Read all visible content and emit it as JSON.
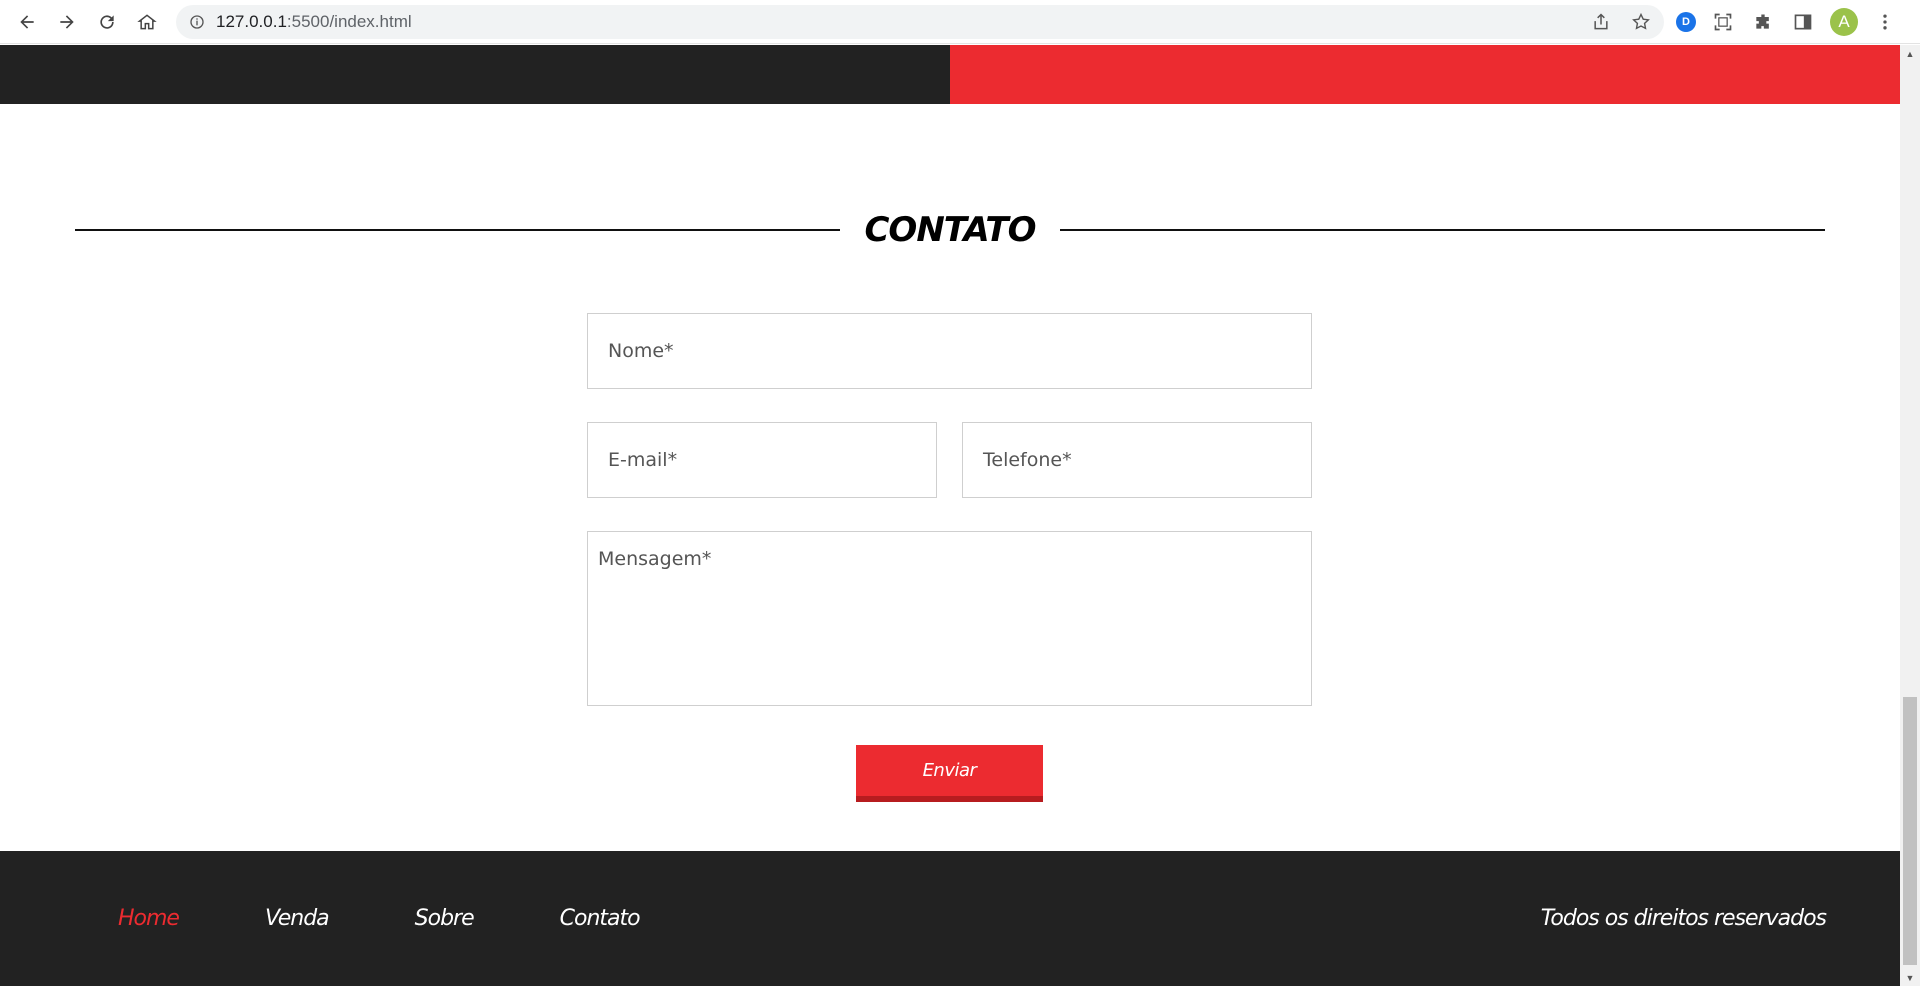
{
  "browser": {
    "url_host": "127.0.0.1",
    "url_path": ":5500/index.html",
    "avatar_letter": "A",
    "extension_label": "D"
  },
  "page": {
    "section_title": "CONTATO",
    "form": {
      "nome_placeholder": "Nome*",
      "email_placeholder": "E-mail*",
      "telefone_placeholder": "Telefone*",
      "mensagem_placeholder": "Mensagem*",
      "submit_label": "Enviar"
    },
    "footer": {
      "nav": [
        {
          "label": "Home",
          "active": true
        },
        {
          "label": "Venda",
          "active": false
        },
        {
          "label": "Sobre",
          "active": false
        },
        {
          "label": "Contato",
          "active": false
        }
      ],
      "copyright": "Todos os direitos reservados"
    }
  },
  "colors": {
    "accent_red": "#ec2b30",
    "dark": "#222222"
  }
}
